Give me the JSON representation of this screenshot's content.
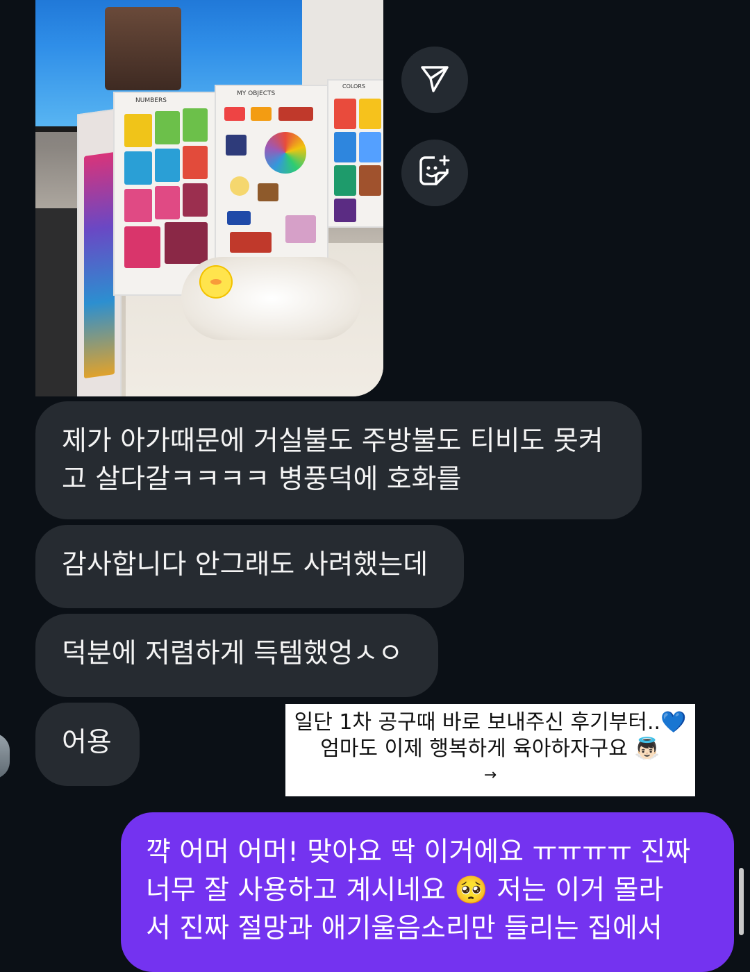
{
  "colors": {
    "background": "#0b1016",
    "received_bubble": "#262b31",
    "sent_bubble": "#7433f0",
    "icon_button": "#242a31"
  },
  "photo_message": {
    "poster_labels": [
      "NUMBERS",
      "MY OBJECTS",
      "COLORS"
    ]
  },
  "actions": {
    "share_icon": "paper-plane-icon",
    "sticker_icon": "sticker-icon"
  },
  "messages": [
    {
      "lines": [
        "제가 아가때문에 거실불도 주방불도 티비도 못켜",
        "고 살다갈ㅋㅋㅋㅋ 병풍덕에 호화를"
      ]
    },
    {
      "lines": [
        "감사합니다 안그래도 사려했는데"
      ]
    },
    {
      "lines": [
        "덕분에 저렴하게 득템했엉ㅅㅇ"
      ]
    },
    {
      "lines": [
        "어용"
      ]
    }
  ],
  "story_card": {
    "line1": "일단 1차 공구때 바로 보내주신 후기부터..",
    "line1_emoji": "💙",
    "line2": "엄마도 이제 행복하게 육아하자구요",
    "line2_emoji": "👼🏻",
    "arrow": "→"
  },
  "sent_message": {
    "line1": "꺅 어머 어머! 맞아요 딱 이거에요 ㅠㅠㅠㅠ 진짜",
    "line2a": "너무 잘 사용하고 계시네요",
    "line2_emoji": "🥺",
    "line2b": "저는 이거 몰라",
    "line3": "서 진짜 절망과 애기울음소리만 들리는 집에서"
  }
}
